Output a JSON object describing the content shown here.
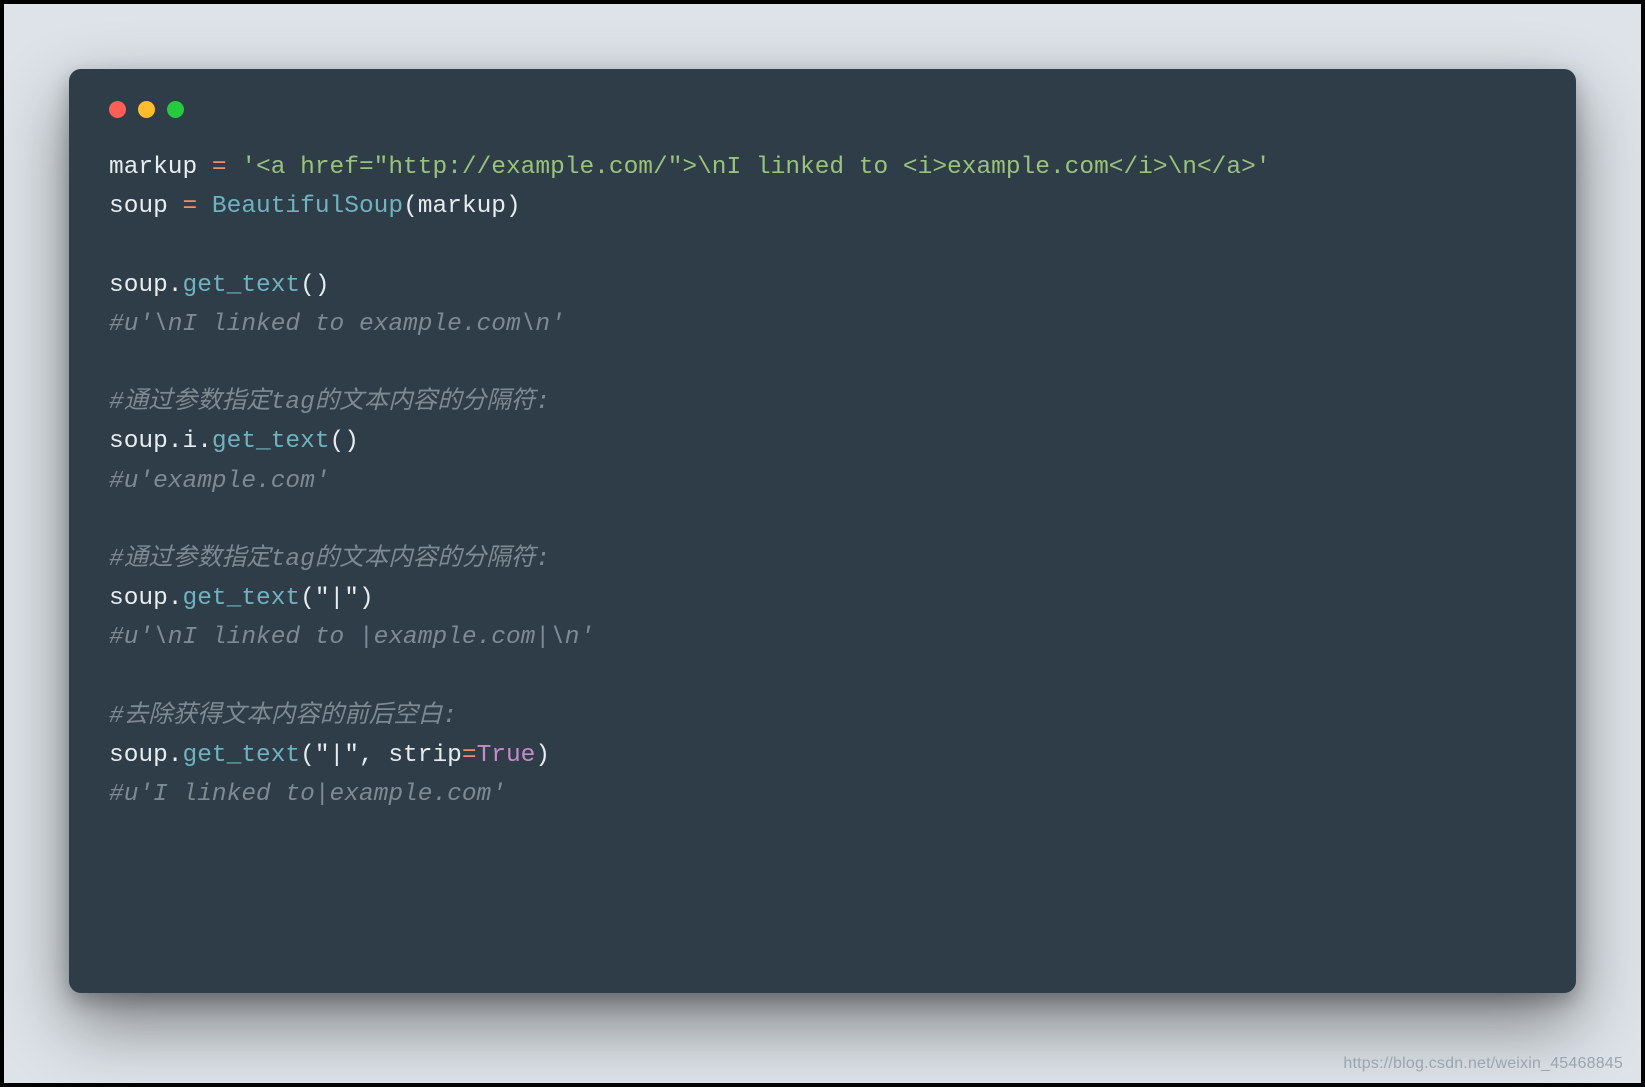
{
  "colors": {
    "page_bg": "#dde3e8",
    "window_bg": "#2e3d47",
    "traffic_red": "#ff5f56",
    "traffic_yellow": "#ffbd2e",
    "traffic_green": "#27c93f",
    "text_default": "#e6ecef",
    "text_operator": "#f08d71",
    "text_string": "#99c27c",
    "text_call": "#6fb3c0",
    "text_comment": "#7e8a92",
    "text_const": "#c38cc7"
  },
  "code": {
    "l1_markup": "markup ",
    "l1_eq": "=",
    "l1_sp": " ",
    "l1_str": "'<a href=\"http://example.com/\">\\nI linked to <i>example.com</i>\\n</a>'",
    "l2_soup": "soup ",
    "l2_eq": "=",
    "l2_sp": " ",
    "l2_fn": "BeautifulSoup",
    "l2_tail": "(markup)",
    "l4_pre": "soup.",
    "l4_fn": "get_text",
    "l4_tail": "()",
    "l5": "#u'\\nI linked to example.com\\n'",
    "l7": "#通过参数指定tag的文本内容的分隔符:",
    "l8_pre": "soup.i.",
    "l8_fn": "get_text",
    "l8_tail": "()",
    "l9": "#u'example.com'",
    "l11": "#通过参数指定tag的文本内容的分隔符:",
    "l12_pre": "soup.",
    "l12_fn": "get_text",
    "l12_tail": "(\"|\")",
    "l13": "#u'\\nI linked to |example.com|\\n'",
    "l15": "#去除获得文本内容的前后空白:",
    "l16_pre": "soup.",
    "l16_fn": "get_text",
    "l16_mid": "(\"|\", strip",
    "l16_eq": "=",
    "l16_true": "True",
    "l16_end": ")",
    "l17": "#u'I linked to|example.com'"
  },
  "watermark": "https://blog.csdn.net/weixin_45468845"
}
